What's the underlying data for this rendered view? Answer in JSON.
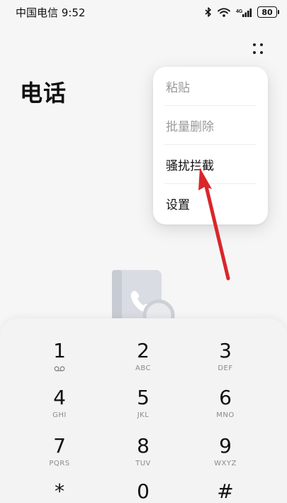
{
  "status_bar": {
    "carrier_time": "中国电信 9:52",
    "network": "⁴ᴳ",
    "battery": "80"
  },
  "page": {
    "title": "电话"
  },
  "menu": {
    "items": [
      {
        "label": "粘贴",
        "enabled": false
      },
      {
        "label": "批量删除",
        "enabled": false
      },
      {
        "label": "骚扰拦截",
        "enabled": true
      },
      {
        "label": "设置",
        "enabled": true
      }
    ]
  },
  "dialpad": {
    "keys": [
      {
        "digit": "1",
        "letters": ""
      },
      {
        "digit": "2",
        "letters": "ABC"
      },
      {
        "digit": "3",
        "letters": "DEF"
      },
      {
        "digit": "4",
        "letters": "GHI"
      },
      {
        "digit": "5",
        "letters": "JKL"
      },
      {
        "digit": "6",
        "letters": "MNO"
      },
      {
        "digit": "7",
        "letters": "PQRS"
      },
      {
        "digit": "8",
        "letters": "TUV"
      },
      {
        "digit": "9",
        "letters": "WXYZ"
      },
      {
        "digit": "*",
        "letters": ""
      },
      {
        "digit": "0",
        "letters": ""
      },
      {
        "digit": "#",
        "letters": ""
      }
    ]
  },
  "icons": {
    "more": "more-dots-icon",
    "voicemail": "voicemail-icon",
    "empty": "contacts-book-icon",
    "annotation": "red-arrow"
  },
  "colors": {
    "annotation_arrow": "#d9262b",
    "menu_disabled_text": "#9a9a9a"
  }
}
